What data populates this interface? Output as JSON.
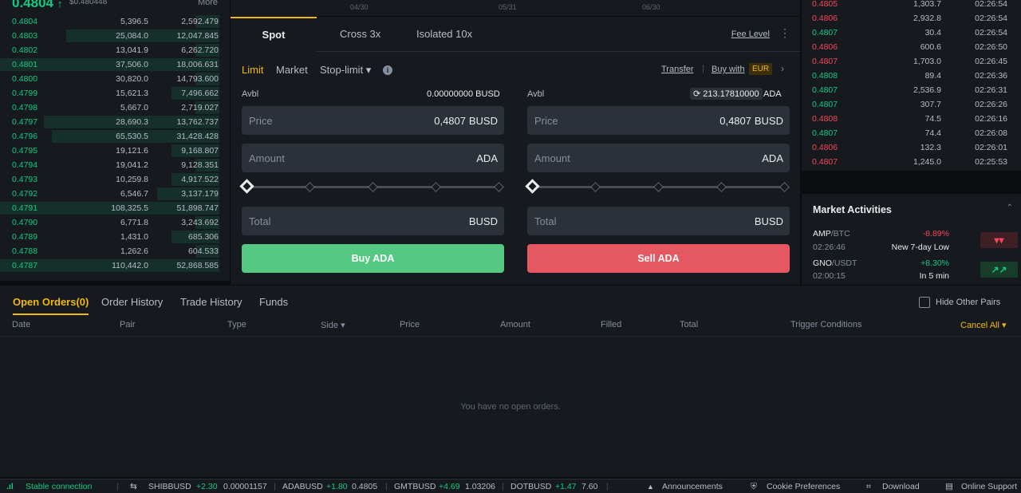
{
  "orderbook": {
    "last_price": "0.4804",
    "last_arrow": "↑",
    "usd_price": "$0.480448",
    "more": "More",
    "rows": [
      {
        "price": "0.4804",
        "amount": "5,396.5",
        "total": "2,592.479"
      },
      {
        "price": "0.4803",
        "amount": "25,084.0",
        "total": "12,047.845"
      },
      {
        "price": "0.4802",
        "amount": "13,041.9",
        "total": "6,262.720"
      },
      {
        "price": "0.4801",
        "amount": "37,506.0",
        "total": "18,006.631"
      },
      {
        "price": "0.4800",
        "amount": "30,820.0",
        "total": "14,793.600"
      },
      {
        "price": "0.4799",
        "amount": "15,621.3",
        "total": "7,496.662"
      },
      {
        "price": "0.4798",
        "amount": "5,667.0",
        "total": "2,719.027"
      },
      {
        "price": "0.4797",
        "amount": "28,690.3",
        "total": "13,762.737"
      },
      {
        "price": "0.4796",
        "amount": "65,530.5",
        "total": "31,428.428"
      },
      {
        "price": "0.4795",
        "amount": "19,121.6",
        "total": "9,168.807"
      },
      {
        "price": "0.4794",
        "amount": "19,041.2",
        "total": "9,128.351"
      },
      {
        "price": "0.4793",
        "amount": "10,259.8",
        "total": "4,917.522"
      },
      {
        "price": "0.4792",
        "amount": "6,546.7",
        "total": "3,137.179"
      },
      {
        "price": "0.4791",
        "amount": "108,325.5",
        "total": "51,898.747"
      },
      {
        "price": "0.4790",
        "amount": "6,771.8",
        "total": "3,243.692"
      },
      {
        "price": "0.4789",
        "amount": "1,431.0",
        "total": "685.306"
      },
      {
        "price": "0.4788",
        "amount": "1,262.6",
        "total": "604.533"
      },
      {
        "price": "0.4787",
        "amount": "110,442.0",
        "total": "52,868.585"
      }
    ]
  },
  "chart": {
    "ticks": [
      "04/30",
      "05/31",
      "06/30"
    ]
  },
  "trade": {
    "tabs": [
      "Spot",
      "Cross 3x",
      "Isolated 10x"
    ],
    "fee_level": "Fee Level",
    "kebab": "⋮",
    "order_types": [
      "Limit",
      "Market",
      "Stop-limit ▾"
    ],
    "info": "i",
    "transfer": "Transfer",
    "buy_with": "Buy with",
    "currency": "EUR",
    "chevron": "›",
    "avbl_label": "Avbl",
    "buy": {
      "avbl": "0.00000000 BUSD",
      "price_label": "Price",
      "price_value": "0,4807",
      "price_unit": "BUSD",
      "amount_label": "Amount",
      "amount_unit": "ADA",
      "total_label": "Total",
      "total_unit": "BUSD",
      "button": "Buy ADA"
    },
    "sell": {
      "avbl_value": "213.17810000",
      "avbl_unit": "ADA",
      "price_label": "Price",
      "price_value": "0,4807",
      "price_unit": "BUSD",
      "amount_label": "Amount",
      "amount_unit": "ADA",
      "total_label": "Total",
      "total_unit": "BUSD",
      "button": "Sell ADA"
    }
  },
  "trades": [
    {
      "price": "0.4805",
      "dir": "down",
      "amount": "1,303.7",
      "time": "02:26:54"
    },
    {
      "price": "0.4806",
      "dir": "down",
      "amount": "2,932.8",
      "time": "02:26:54"
    },
    {
      "price": "0.4807",
      "dir": "up",
      "amount": "30.4",
      "time": "02:26:54"
    },
    {
      "price": "0.4806",
      "dir": "down",
      "amount": "600.6",
      "time": "02:26:50"
    },
    {
      "price": "0.4807",
      "dir": "down",
      "amount": "1,703.0",
      "time": "02:26:45"
    },
    {
      "price": "0.4808",
      "dir": "up",
      "amount": "89.4",
      "time": "02:26:36"
    },
    {
      "price": "0.4807",
      "dir": "up",
      "amount": "2,536.9",
      "time": "02:26:31"
    },
    {
      "price": "0.4807",
      "dir": "up",
      "amount": "307.7",
      "time": "02:26:26"
    },
    {
      "price": "0.4808",
      "dir": "down",
      "amount": "74.5",
      "time": "02:26:16"
    },
    {
      "price": "0.4807",
      "dir": "up",
      "amount": "74.4",
      "time": "02:26:08"
    },
    {
      "price": "0.4806",
      "dir": "down",
      "amount": "132.3",
      "time": "02:26:01"
    },
    {
      "price": "0.4807",
      "dir": "down",
      "amount": "1,245.0",
      "time": "02:25:53"
    }
  ],
  "market": {
    "title": "Market Activities",
    "caret": "⌃",
    "items": [
      {
        "base": "AMP",
        "quote": "/BTC",
        "time": "02:26:46",
        "change": "-8.89%",
        "desc": "New 7-day Low",
        "icon": "▾▾",
        "dir": "down"
      },
      {
        "base": "GNO",
        "quote": "/USDT",
        "time": "02:00:15",
        "change": "+8.30%",
        "desc": "In 5 min",
        "icon": "↗↗",
        "dir": "up"
      }
    ]
  },
  "orders": {
    "tabs": [
      "Open Orders(0)",
      "Order History",
      "Trade History",
      "Funds"
    ],
    "hide_other": "Hide Other Pairs",
    "columns": [
      "Date",
      "Pair",
      "Type",
      "Side ▾",
      "Price",
      "Amount",
      "Filled",
      "Total",
      "Trigger Conditions"
    ],
    "cancel_all": "Cancel All ▾",
    "empty": "You have no open orders."
  },
  "footer": {
    "connection": "Stable connection",
    "signal_icon": ".ıl",
    "settings_icon": "⇆",
    "tickers": [
      {
        "sym": "SHIBBUSD",
        "chg": "+2.30",
        "price": "0.00001157"
      },
      {
        "sym": "ADABUSD",
        "chg": "+1.80",
        "price": "0.4805"
      },
      {
        "sym": "GMTBUSD",
        "chg": "+4.69",
        "price": "1.03206"
      },
      {
        "sym": "DOTBUSD",
        "chg": "+1.47",
        "price": "7.60"
      }
    ],
    "links": [
      "Announcements",
      "Cookie Preferences",
      "Download",
      "Online Support"
    ],
    "link_icons": [
      "▲",
      "⛨",
      "⌗",
      "▤"
    ]
  }
}
